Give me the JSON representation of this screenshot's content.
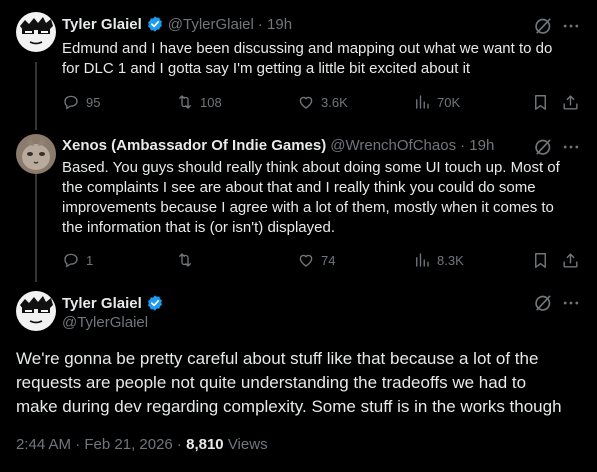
{
  "tweets": [
    {
      "name": "Tyler Glaiel",
      "handle": "@TylerGlaiel",
      "time": "· 19h",
      "text_lines": [
        "Edmund and I have been discussing and mapping out what we want to do",
        "for DLC 1 and I gotta say I'm getting a little bit excited about it"
      ],
      "replies": "95",
      "reposts": "108",
      "likes": "3.6K",
      "views": "70K"
    },
    {
      "name": "Xenos (Ambassador Of Indie Games)",
      "handle": "@WrenchOfChaos",
      "time": "· 19h",
      "text_lines": [
        "Based. You guys should really think about doing some UI touch up. Most of",
        "the complaints I see are about that and I really think you could do some",
        "improvements because I agree with a lot of them, mostly when it comes to",
        "the information that is (or isn't) displayed."
      ],
      "replies": "1",
      "reposts": "",
      "likes": "74",
      "views": "8.3K"
    }
  ],
  "main": {
    "name": "Tyler Glaiel",
    "handle": "@TylerGlaiel",
    "text_lines": [
      "We're gonna be pretty careful about stuff like that because a lot of the",
      "requests are people not quite understanding the tradeoffs we had to",
      "make during dev regarding complexity. Some stuff is in the works though"
    ],
    "timestamp": "2:44 AM · Feb 21, 2026 · ",
    "views_count": "8,810",
    "views_label": " Views"
  },
  "icons": [
    "verified-badge-icon",
    "grok-icon",
    "more-icon",
    "reply-icon",
    "repost-icon",
    "like-icon",
    "views-icon",
    "bookmark-icon",
    "share-icon"
  ],
  "colors": {
    "background": "#000000",
    "text": "#e7e9ea",
    "muted": "#71767b",
    "verified": "#1d9bf0"
  }
}
